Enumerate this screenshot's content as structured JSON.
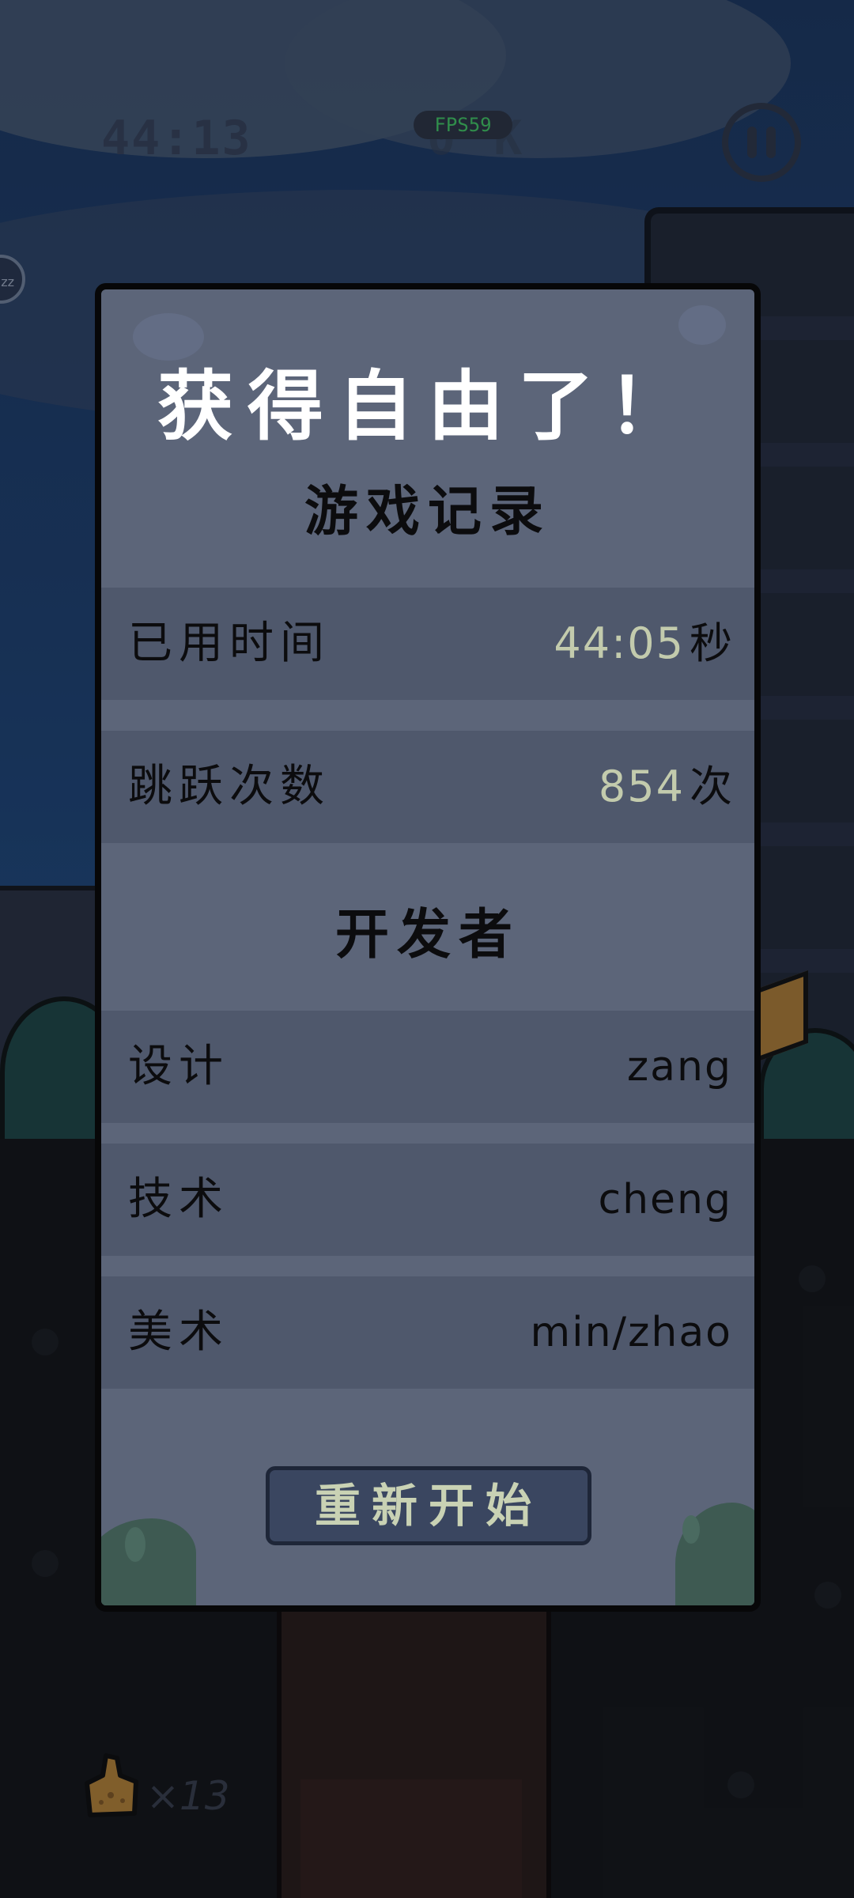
{
  "hud": {
    "timer": "44:13",
    "fps": "FPS59",
    "ghost_text": "0 K",
    "pause_icon": "pause-icon",
    "side_bubble": "zz",
    "coin_icon": "bread-coin-icon",
    "coin_count": "×13"
  },
  "dialog": {
    "title": "获得自由了！",
    "record_header": "游戏记录",
    "stats": [
      {
        "label": "已用时间",
        "number": "44:05",
        "unit": "秒"
      },
      {
        "label": "跳跃次数",
        "number": "854",
        "unit": "次"
      }
    ],
    "dev_header": "开发者",
    "developers": [
      {
        "role": "设计",
        "name": "zang"
      },
      {
        "role": "技术",
        "name": "cheng"
      },
      {
        "role": "美术",
        "name": "min/zhao"
      }
    ],
    "restart_label": "重新开始"
  },
  "colors": {
    "dialog_bg": "#5c6579",
    "row_bg": "#4f586c",
    "number_accent": "#c3cbad",
    "fps_green": "#46d36b",
    "title_white": "#ffffff"
  }
}
